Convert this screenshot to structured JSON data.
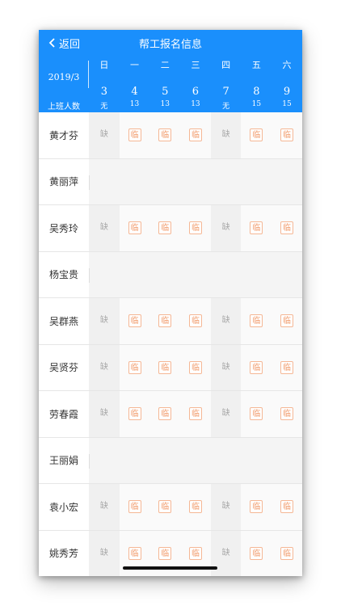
{
  "header": {
    "back_label": "返回",
    "title": "帮工报名信息",
    "month": "2019/3",
    "count_label": "上班人数"
  },
  "days": [
    {
      "weekday": "日",
      "date": "3",
      "count": "无",
      "weekend": true
    },
    {
      "weekday": "一",
      "date": "4",
      "count": "13",
      "weekend": false
    },
    {
      "weekday": "二",
      "date": "5",
      "count": "13",
      "weekend": false
    },
    {
      "weekday": "三",
      "date": "6",
      "count": "13",
      "weekend": false
    },
    {
      "weekday": "四",
      "date": "7",
      "count": "无",
      "weekend": true
    },
    {
      "weekday": "五",
      "date": "8",
      "count": "15",
      "weekend": false
    },
    {
      "weekday": "六",
      "date": "9",
      "count": "15",
      "weekend": false
    }
  ],
  "labels": {
    "absent": "缺",
    "temp": "临"
  },
  "workers": [
    {
      "name": "黄才芬",
      "scheduled": true
    },
    {
      "name": "黄丽萍",
      "scheduled": false
    },
    {
      "name": "吴秀玲",
      "scheduled": true
    },
    {
      "name": "杨宝贵",
      "scheduled": false
    },
    {
      "name": "吴群燕",
      "scheduled": true
    },
    {
      "name": "吴贤芬",
      "scheduled": true
    },
    {
      "name": "劳春霞",
      "scheduled": true
    },
    {
      "name": "王丽娟",
      "scheduled": false
    },
    {
      "name": "袁小宏",
      "scheduled": true
    },
    {
      "name": "姚秀芳",
      "scheduled": true
    }
  ],
  "colors": {
    "header_bg": "#1a8ffc",
    "temp_tag": "#f19a6a",
    "absent_tag": "#a8a8a8"
  },
  "icons": {
    "back": "chevron-left-icon"
  }
}
